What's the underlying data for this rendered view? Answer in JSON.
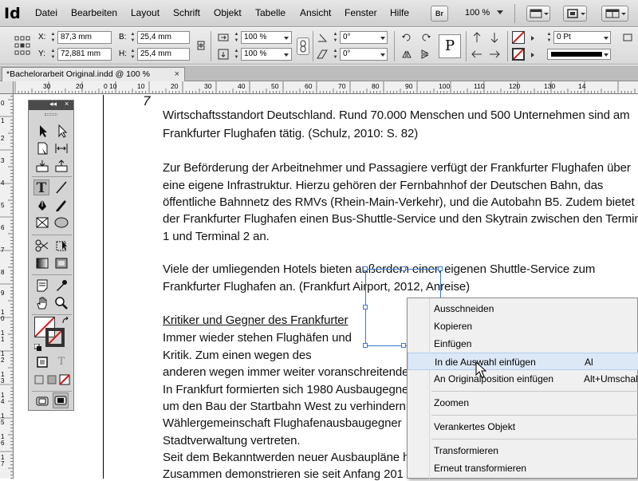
{
  "app": {
    "logo": "Id"
  },
  "menubar": {
    "items": [
      "Datei",
      "Bearbeiten",
      "Layout",
      "Schrift",
      "Objekt",
      "Tabelle",
      "Ansicht",
      "Fenster",
      "Hilfe"
    ],
    "br_label": "Br",
    "zoom": "100 %"
  },
  "control_panel": {
    "x_label": "X:",
    "x_value": "87,3 mm",
    "y_label": "Y:",
    "y_value": "72,881 mm",
    "b_label": "B:",
    "b_value": "25,4 mm",
    "h_label": "H:",
    "h_value": "25,4 mm",
    "scale_x": "100 %",
    "scale_y": "100 %",
    "rotate": "0°",
    "shear": "0°",
    "stroke_weight": "0 Pt",
    "p_label": "P"
  },
  "tab": {
    "title": "*Bachelorarbeit Original.indd @ 100 %",
    "close": "×"
  },
  "ruler_h": [
    "30",
    "20",
    "10",
    "0",
    "10",
    "20",
    "30",
    "40",
    "50",
    "60",
    "70",
    "80",
    "90",
    "100",
    "110",
    "120",
    "130",
    "14"
  ],
  "ruler_v": [
    "0",
    "1",
    "2",
    "3",
    "4",
    "5",
    "6",
    "7",
    "8",
    "9",
    "1 0",
    "1 1",
    "1 2",
    "1 3",
    "1 4",
    "1 5",
    "1 6",
    "1 7"
  ],
  "tools_panel": {
    "collapse": "◂◂",
    "close": "×"
  },
  "document": {
    "page_number": "7",
    "lines": [
      "Wirtschaftsstandort Deutschland. Rund 70.000 Menschen und 500 Unternehmen sind am",
      "Frankfurter Flughafen tätig. (Schulz, 2010: S. 82)",
      "Zur Beförderung der Arbeitnehmer und Passagiere verfügt der Frankfurter Flughafen über",
      "eine eigene Infrastruktur. Hierzu gehören der Fernbahnhof der Deutschen Bahn, das",
      "öffentliche Bahnnetz des RMVs (Rhein-Main-Verkehr), und die Autobahn B5. Zudem bietet",
      "der Frankfurter Flughafen einen Bus-Shuttle-Service und den Skytrain zwischen den Terminal",
      "1 und Terminal 2 an.",
      "Viele der umliegenden Hotels bieten außerdem einen eigenen Shuttle-Service zum",
      "Frankfurter Flughafen an. (Frankfurt Airport, 2012, Anreise)",
      "Kritiker und Gegner des Frankfurter",
      "Immer wieder stehen Flughäfen und",
      "Kritik. Zum einen wegen des",
      "anderen wegen immer weiter voranschreitende",
      "In Frankfurt formierten sich 1980 Ausbaugegne",
      "um den Bau der Startbahn West zu verhindern",
      "Wählergemeinschaft Flughafenausbaugegner",
      "Stadtverwaltung vertreten.",
      "Seit dem Bekanntwerden neuer Ausbaupläne h",
      "Zusammen demonstrieren sie seit Anfang 201"
    ]
  },
  "context_menu": {
    "items": [
      {
        "label": "Ausschneiden",
        "shortcut": ""
      },
      {
        "label": "Kopieren",
        "shortcut": ""
      },
      {
        "label": "Einfügen",
        "shortcut": ""
      },
      {
        "label": "In die Auswahl einfügen",
        "shortcut": "Al"
      },
      {
        "label": "An Originalposition einfügen",
        "shortcut": "Alt+Umschal"
      },
      {
        "label": "Zoomen",
        "shortcut": ""
      },
      {
        "label": "Verankertes Objekt",
        "shortcut": ""
      },
      {
        "label": "Transformieren",
        "shortcut": ""
      },
      {
        "label": "Erneut transformieren",
        "shortcut": ""
      }
    ]
  },
  "colors": {
    "selection": "#3a78c9",
    "menu_hover": "#dde8f7",
    "none_swatch_red": "#d11a1a"
  }
}
